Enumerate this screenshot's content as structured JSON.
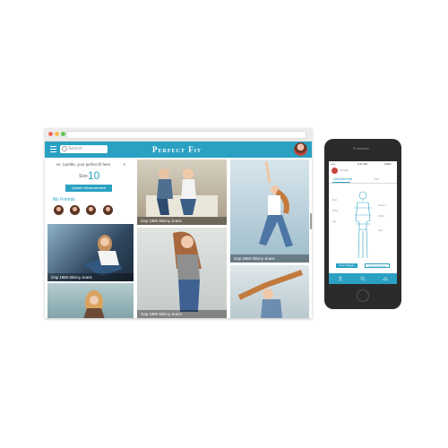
{
  "browser": {
    "app_title": "Perfect Fit",
    "search_placeholder": "Search",
    "greeting": "Hi, Camille, your perfect fit here",
    "size_label": "Size",
    "size_value": "10",
    "update_button": "Update Measurement",
    "friends_label": "My Friends",
    "captions": [
      "Gap 1969 Skinny Jeans",
      "Gap 1969 Skinny Jeans",
      "Gap 1969 Skinny Jeans",
      "Gap 1969 Skinny Jeans"
    ],
    "colors": {
      "accent": "#2aa1c2",
      "chrome": "#ececec"
    }
  },
  "phone": {
    "status": {
      "carrier": "••••• ",
      "time": "9:41 AM",
      "battery": "100%"
    },
    "user_name": "Camille",
    "tabs": [
      "Measurements",
      "Size"
    ],
    "measure_labels": [
      "Bust",
      "Waist",
      "Hip",
      "Inseam",
      "Thigh",
      "Calf"
    ],
    "buttons": [
      "Save Changes",
      "Cancel Changes"
    ],
    "nav_icons": [
      "user-icon",
      "search-icon",
      "hanger-icon"
    ]
  }
}
